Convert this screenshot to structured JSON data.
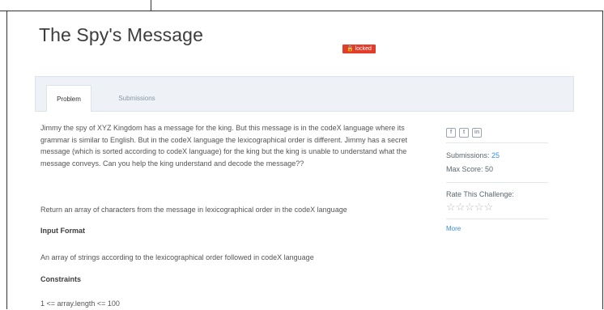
{
  "challenge": {
    "title": "The Spy's Message",
    "badge": "locked"
  },
  "tabs": [
    {
      "label": "Problem",
      "active": true
    },
    {
      "label": "Submissions",
      "active": false
    }
  ],
  "problem": {
    "description": "Jimmy the spy of XYZ Kingdom has a message for the king. But this message is in the codeX language where its grammar is similar to English. But in the codeX language the lexicographical order is different. Jimmy has a secret message (which is sorted according to codeX language) for the king but the king is unable to understand what the message conveys. Can you help the king understand and decode the message??",
    "task": "Return an array of characters from the message in lexicographical order in the codeX language",
    "input_heading": "Input Format",
    "input_text": "An array of strings according to the lexicographical order followed in codeX language",
    "constraints_heading": "Constraints",
    "constraints_text": "1 <= array.length <= 100"
  },
  "sidebar": {
    "social_icons": [
      "facebook-icon",
      "twitter-icon",
      "linkedin-icon"
    ],
    "submissions_label": "Submissions:",
    "submissions_value": "25",
    "max_score_label": "Max Score:",
    "max_score_value": "50",
    "rate_label": "Rate This Challenge:",
    "rating_stars": "☆☆☆☆☆",
    "more_link": "More"
  },
  "colors": {
    "badge": "#e23c2a",
    "link": "#3a8ed6",
    "tab_bar": "#eef2f6"
  }
}
